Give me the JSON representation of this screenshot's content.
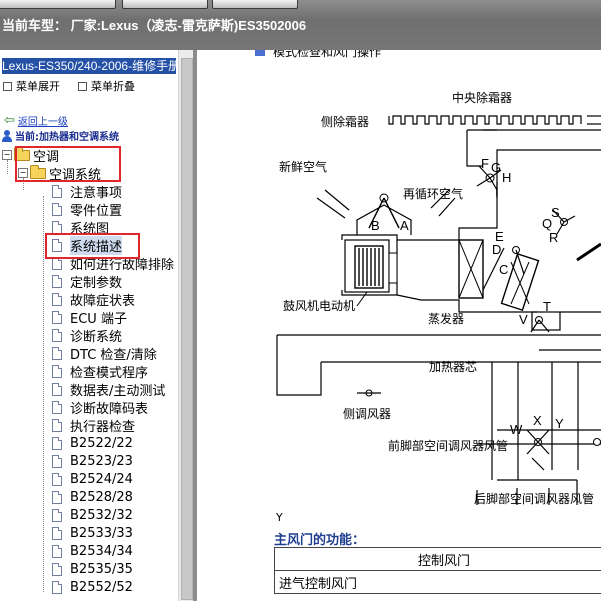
{
  "header": {
    "current_car_label": "当前车型： 厂家:Lexus（凌志-雷克萨斯)ES3502006"
  },
  "sidebar": {
    "manual_title": "Lexus-ES350/240-2006-维修手册",
    "expand_menu": "菜单展开",
    "collapse_menu": "菜单折叠",
    "back_link": "返回上一级",
    "current_location": "当前:加热器和空调系统",
    "tree": {
      "folder_level1": "空调",
      "folder_level2": "空调系统",
      "items": [
        "注意事项",
        "零件位置",
        "系统图",
        "系统描述",
        "如何进行故障排除",
        "定制参数",
        "故障症状表",
        "ECU 端子",
        "诊断系统",
        "DTC 检查/清除",
        "检查模式程序",
        "数据表/主动测试",
        "诊断故障码表",
        "执行器检查",
        "B2522/22",
        "B2523/23",
        "B2524/24",
        "B2528/28",
        "B2532/32",
        "B2533/33",
        "B2534/34",
        "B2535/35",
        "B2552/52"
      ],
      "selected_item": "系统描述"
    }
  },
  "diagram": {
    "section_heading": "模式检查和风门操作",
    "labels": {
      "center_defrost": "中央除霜器",
      "side_defrost": "侧除霜器",
      "fresh_air": "新鲜空气",
      "recirc_air": "再循环空气",
      "blower_motor": "鼓风机电动机",
      "evaporator": "蒸发器",
      "heater_core": "加热器芯",
      "side_register": "侧调风器",
      "front_foot_duct": "前脚部空间调风器风管",
      "rear_foot_duct": "后脚部空间调风器风管"
    },
    "letters": [
      "A",
      "B",
      "C",
      "D",
      "E",
      "F",
      "G",
      "H",
      "I",
      "Q",
      "R",
      "S",
      "T",
      "V",
      "W",
      "X",
      "Y"
    ]
  },
  "main": {
    "y_marker": "Y",
    "function_title": "主风门的功能：",
    "table": {
      "header": "控制风门",
      "row1": "进气控制风门"
    }
  }
}
